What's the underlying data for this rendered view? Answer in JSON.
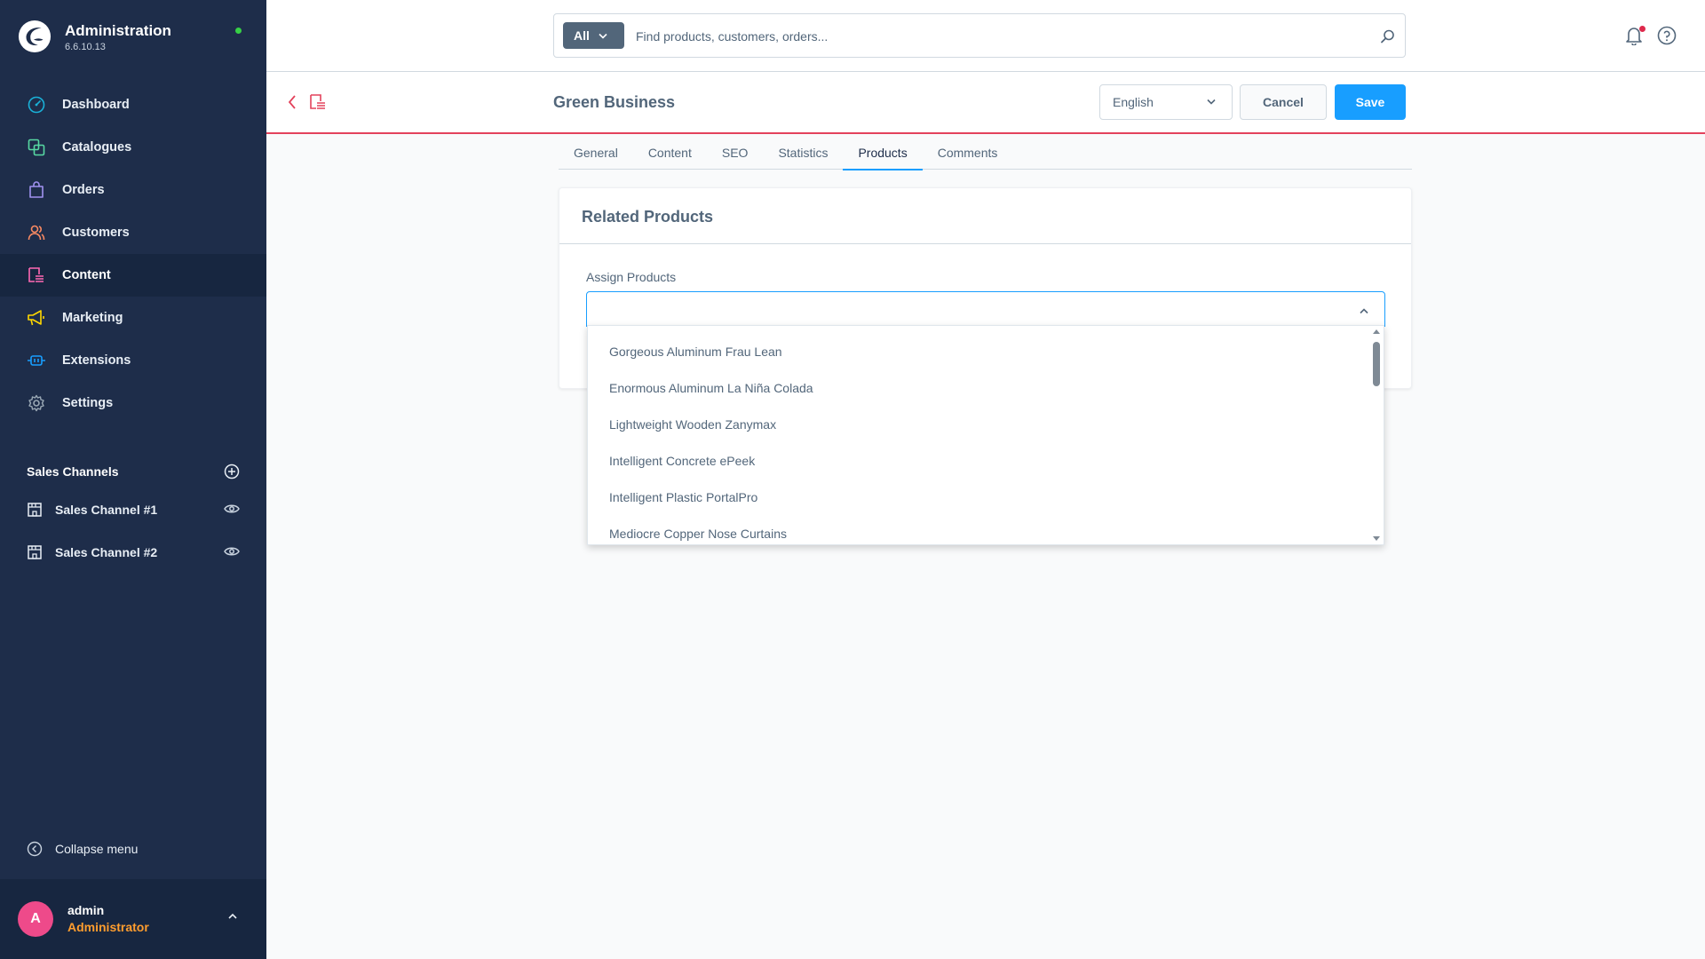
{
  "app": {
    "title": "Administration",
    "version": "6.6.10.13",
    "accent_color": "#189eff",
    "sidebar_color": "#1e2d4a"
  },
  "sidebar": {
    "items": [
      {
        "label": "Dashboard",
        "icon": "dashboard-icon",
        "color": "#1ab1d8"
      },
      {
        "label": "Catalogues",
        "icon": "catalogues-icon",
        "color": "#57d9a3"
      },
      {
        "label": "Orders",
        "icon": "orders-icon",
        "color": "#a092f0"
      },
      {
        "label": "Customers",
        "icon": "customers-icon",
        "color": "#f88962"
      },
      {
        "label": "Content",
        "icon": "content-icon",
        "color": "#ff68b4",
        "active": true
      },
      {
        "label": "Marketing",
        "icon": "marketing-icon",
        "color": "#ffd700"
      },
      {
        "label": "Extensions",
        "icon": "extensions-icon",
        "color": "#189eff"
      },
      {
        "label": "Settings",
        "icon": "settings-icon",
        "color": "#9aa8b5"
      }
    ],
    "sales_channels_title": "Sales Channels",
    "sales_channels": [
      {
        "label": "Sales Channel #1"
      },
      {
        "label": "Sales Channel #2"
      }
    ],
    "collapse_label": "Collapse menu",
    "user": {
      "initial": "A",
      "name": "admin",
      "role": "Administrator"
    }
  },
  "search": {
    "type_label": "All",
    "placeholder": "Find products, customers, orders..."
  },
  "smartbar": {
    "title": "Green Business",
    "language": "English",
    "cancel_label": "Cancel",
    "save_label": "Save"
  },
  "tabs": [
    {
      "label": "General"
    },
    {
      "label": "Content"
    },
    {
      "label": "SEO"
    },
    {
      "label": "Statistics"
    },
    {
      "label": "Products",
      "active": true
    },
    {
      "label": "Comments"
    }
  ],
  "card": {
    "title": "Related Products",
    "field_label": "Assign Products"
  },
  "dropdown": {
    "options": [
      "Gorgeous Aluminum Frau Lean",
      "Enormous Aluminum La Niña Colada",
      "Lightweight Wooden Zanymax",
      "Intelligent Concrete ePeek",
      "Intelligent Plastic PortalPro",
      "Mediocre Copper Nose Curtains"
    ]
  }
}
